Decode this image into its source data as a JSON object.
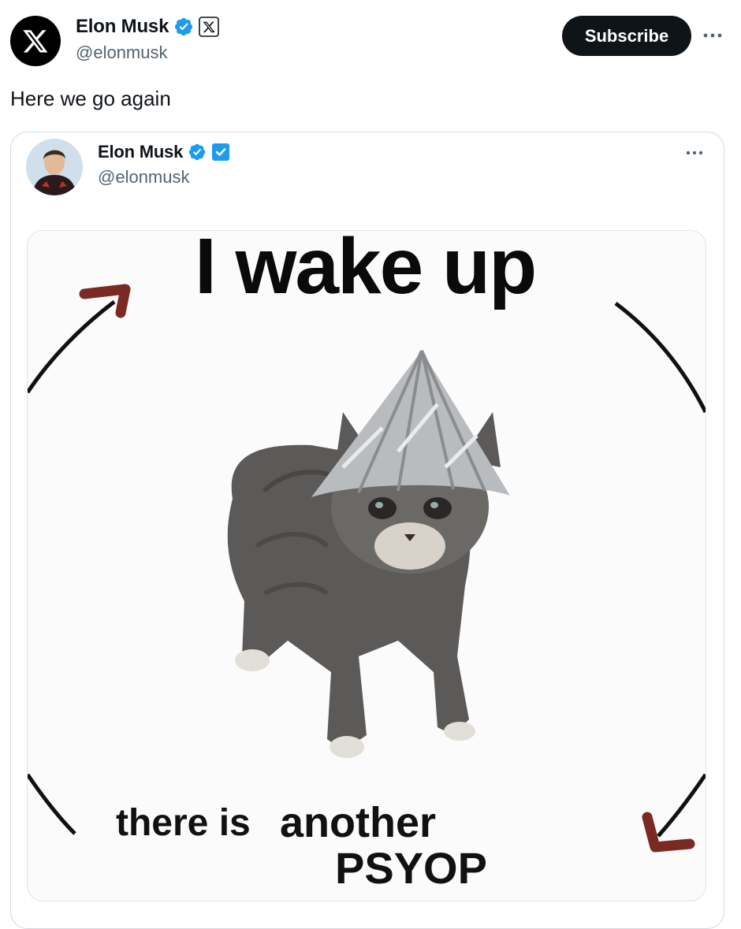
{
  "post": {
    "author_name": "Elon Musk",
    "author_handle": "@elonmusk",
    "subscribe_label": "Subscribe",
    "text": "Here we go again",
    "avatar_icon": "x-logo-icon",
    "verified_badge_color": "#1d9bf0"
  },
  "quoted_post": {
    "author_name": "Elon Musk",
    "author_handle": "@elonmusk",
    "meme": {
      "top_text": "I wake up",
      "bottom_text_1": "there is",
      "bottom_text_2": "another",
      "bottom_text_3": "PSYOP"
    }
  },
  "colors": {
    "text_primary": "#0f1419",
    "text_secondary": "#536471",
    "border": "#cfd9de",
    "button_bg": "#0f1419",
    "arrow_red": "#7a2a22"
  }
}
